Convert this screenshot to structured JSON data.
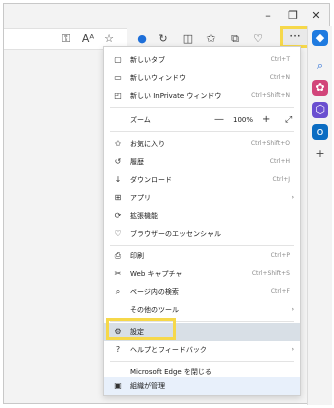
{
  "window": {
    "minimize": "–",
    "restore": "❐",
    "close": "✕"
  },
  "toolbar": {
    "icons": [
      "key-icon",
      "read-aloud-icon",
      "favorite-star-icon",
      "extension-icon",
      "refresh-icon",
      "split-screen-icon",
      "favorites-icon",
      "collections-icon",
      "performance-icon"
    ],
    "more_label": "···"
  },
  "menu": {
    "new_tab": {
      "label": "新しいタブ",
      "shortcut": "Ctrl+T"
    },
    "new_window": {
      "label": "新しいウィンドウ",
      "shortcut": "Ctrl+N"
    },
    "new_inprivate": {
      "label": "新しい InPrivate ウィンドウ",
      "shortcut": "Ctrl+Shift+N"
    },
    "zoom": {
      "label": "ズーム",
      "minus": "—",
      "value": "100%",
      "plus": "+",
      "full": "⤢"
    },
    "favorites": {
      "label": "お気に入り",
      "shortcut": "Ctrl+Shift+O"
    },
    "history": {
      "label": "履歴",
      "shortcut": "Ctrl+H"
    },
    "downloads": {
      "label": "ダウンロード",
      "shortcut": "Ctrl+J"
    },
    "apps": {
      "label": "アプリ",
      "arrow": "›"
    },
    "extensions": {
      "label": "拡張機能"
    },
    "essentials": {
      "label": "ブラウザーのエッセンシャル"
    },
    "print": {
      "label": "印刷",
      "shortcut": "Ctrl+P"
    },
    "web_capture": {
      "label": "Web キャプチャ",
      "shortcut": "Ctrl+Shift+S"
    },
    "find": {
      "label": "ページ内の検索",
      "shortcut": "Ctrl+F"
    },
    "more_tools": {
      "label": "その他のツール",
      "arrow": "›"
    },
    "settings": {
      "label": "設定"
    },
    "help": {
      "label": "ヘルプとフィードバック",
      "arrow": "›"
    },
    "close_edge": {
      "label": "Microsoft Edge を閉じる"
    },
    "org_managed": {
      "label": "組織が管理"
    }
  },
  "colors": {
    "highlight_box": "#f6d84a",
    "selected_row": "#d8dfe6"
  }
}
